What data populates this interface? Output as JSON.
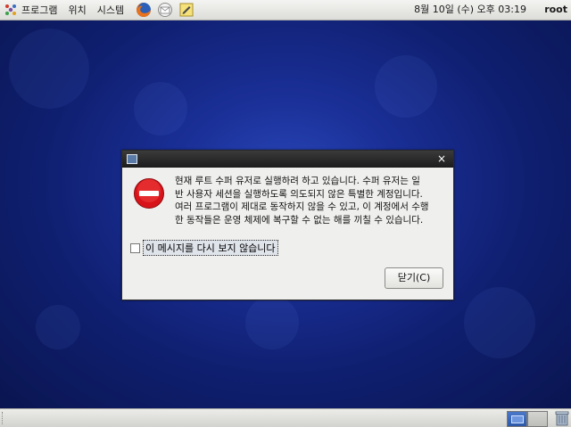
{
  "top_panel": {
    "menus": [
      "프로그램",
      "위치",
      "시스템"
    ],
    "launchers": [
      "firefox-icon",
      "mail-icon",
      "notes-icon"
    ],
    "clock": "8월 10일 (수) 오후 03:19",
    "user": "root"
  },
  "dialog": {
    "message": "현재 루트 수퍼 유저로 실행하려 하고 있습니다. 수퍼 유저는 일\n반 사용자 세션을 실행하도록 의도되지 않은 특별한 계정입니다.\n여러 프로그램이 제대로 동작하지 않을 수 있고, 이 계정에서 수행\n한 동작들은 운영 체제에 복구할 수 없는 해를 끼칠 수 있습니다.",
    "checkbox_label": "이 메시지를 다시 보지 않습니다",
    "checkbox_checked": false,
    "close_button": "닫기(C)",
    "close_icon": "×",
    "icon": "stop-icon"
  },
  "colors": {
    "desktop": "#1a2f96",
    "stop_red": "#d8141a",
    "titlebar": "#2a2a2a"
  }
}
